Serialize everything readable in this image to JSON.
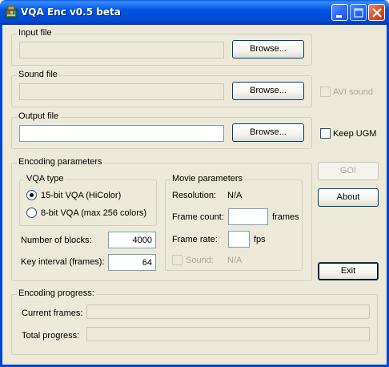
{
  "window": {
    "title": "VQA Enc v0.5 beta"
  },
  "input_file": {
    "label": "Input file",
    "value": "",
    "browse_label": "Browse..."
  },
  "sound_file": {
    "label": "Sound file",
    "value": "",
    "browse_label": "Browse...",
    "avi_sound_label": "AVI sound",
    "avi_sound_checked": false,
    "avi_sound_enabled": false
  },
  "output_file": {
    "label": "Output file",
    "value": "",
    "browse_label": "Browse...",
    "keep_ugm_label": "Keep UGM",
    "keep_ugm_checked": false
  },
  "encoding_parameters": {
    "label": "Encoding parameters",
    "vqa_type": {
      "label": "VQA type",
      "options": [
        "15-bit VQA (HiColor)",
        "8-bit VQA (max 256 colors)"
      ],
      "selected": "15-bit VQA (HiColor)"
    },
    "number_of_blocks_label": "Number of blocks:",
    "number_of_blocks": "4000",
    "key_interval_label": "Key interval (frames):",
    "key_interval": "64",
    "movie_parameters": {
      "label": "Movie parameters",
      "resolution_label": "Resolution:",
      "resolution_value": "N/A",
      "frame_count_label": "Frame count:",
      "frame_count_value": "",
      "frame_count_unit": "frames",
      "frame_rate_label": "Frame rate:",
      "frame_rate_value": "",
      "frame_rate_unit": "fps",
      "sound_label": "Sound:",
      "sound_value": "N/A"
    }
  },
  "actions": {
    "go_label": "GO!",
    "about_label": "About",
    "exit_label": "Exit"
  },
  "encoding_progress": {
    "label": "Encoding progress:",
    "current_frames_label": "Current frames:",
    "current_frames_fraction": 0,
    "total_progress_label": "Total progress:",
    "total_progress_fraction": 0
  },
  "colors": {
    "titlebar": "#0046d1",
    "face": "#ece9d8",
    "disabled_text": "#aca899"
  }
}
